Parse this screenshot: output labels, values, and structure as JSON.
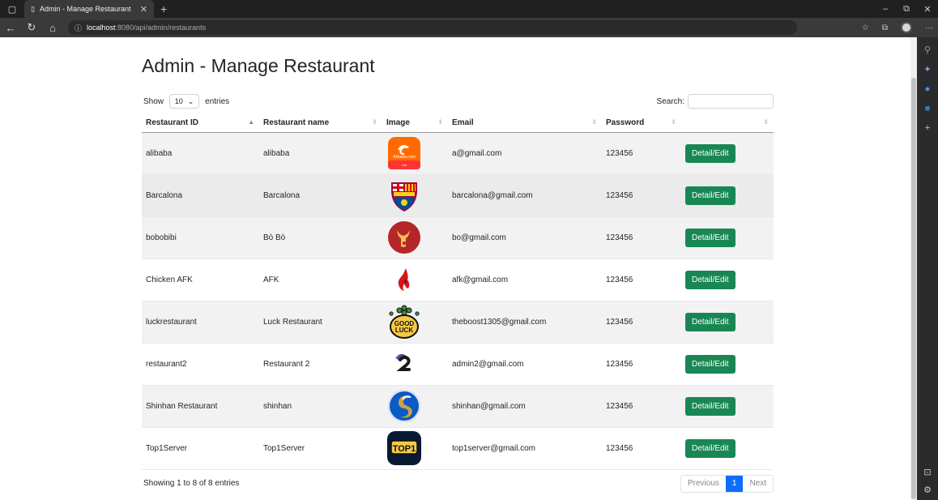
{
  "browser": {
    "tab_title": "Admin - Manage Restaurant",
    "url_host": "localhost",
    "url_path": ":8080/api/admin/restaurants"
  },
  "page": {
    "title": "Admin - Manage Restaurant",
    "show_label": "Show",
    "entries_value": "10",
    "entries_label": "entries",
    "search_label": "Search:",
    "search_value": ""
  },
  "table": {
    "headers": [
      "Restaurant ID",
      "Restaurant name",
      "Image",
      "Email",
      "Password",
      ""
    ],
    "rows": [
      {
        "id": "alibaba",
        "name": "alibaba",
        "logo": "alibaba-logo-icon",
        "email": "a@gmail.com",
        "password": "123456",
        "action": "Detail/Edit"
      },
      {
        "id": "Barcalona",
        "name": "Barcalona",
        "logo": "fcb-crest-icon",
        "email": "barcalona@gmail.com",
        "password": "123456",
        "action": "Detail/Edit"
      },
      {
        "id": "bobobibi",
        "name": "Bò Bò",
        "logo": "bull-logo-icon",
        "email": "bo@gmail.com",
        "password": "123456",
        "action": "Detail/Edit"
      },
      {
        "id": "Chicken AFK",
        "name": "AFK",
        "logo": "red-flame-icon",
        "email": "afk@gmail.com",
        "password": "123456",
        "action": "Detail/Edit"
      },
      {
        "id": "luckrestaurant",
        "name": "Luck Restaurant",
        "logo": "good-luck-logo-icon",
        "email": "theboost1305@gmail.com",
        "password": "123456",
        "action": "Detail/Edit"
      },
      {
        "id": "restaurant2",
        "name": "Restaurant 2",
        "logo": "number-2-logo-icon",
        "email": "admin2@gmail.com",
        "password": "123456",
        "action": "Detail/Edit"
      },
      {
        "id": "Shinhan Restaurant",
        "name": "shinhan",
        "logo": "shinhan-logo-icon",
        "email": "shinhan@gmail.com",
        "password": "123456",
        "action": "Detail/Edit"
      },
      {
        "id": "Top1Server",
        "name": "Top1Server",
        "logo": "top1-logo-icon",
        "email": "top1server@gmail.com",
        "password": "123456",
        "action": "Detail/Edit"
      }
    ]
  },
  "footer": {
    "info": "Showing 1 to 8 of 8 entries",
    "prev": "Previous",
    "page": "1",
    "next": "Next"
  }
}
